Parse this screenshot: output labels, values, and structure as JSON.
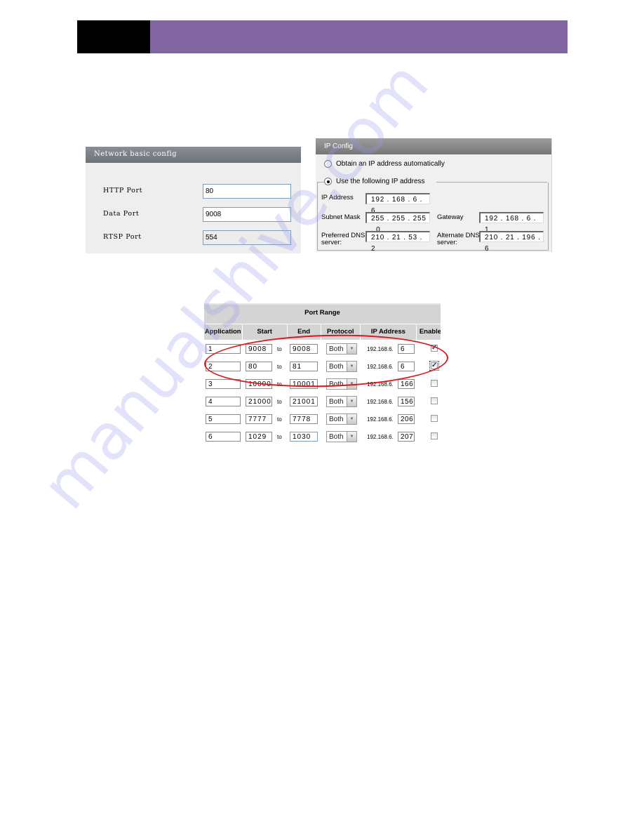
{
  "header": {
    "colors": {
      "left_block": "#000000",
      "band": "#8065a0"
    }
  },
  "network_basic_config": {
    "title": "Network basic config",
    "fields": [
      {
        "label": "HTTP Port",
        "value": "80",
        "disabled": false
      },
      {
        "label": "Data Port",
        "value": "9008",
        "disabled": false
      },
      {
        "label": "RTSP Port",
        "value": "554",
        "disabled": true
      }
    ]
  },
  "ip_config": {
    "title": "IP Config",
    "options": [
      {
        "label": "Obtain an IP address automatically",
        "selected": false
      },
      {
        "label": "Use the following IP address",
        "selected": true
      }
    ],
    "ip_address": {
      "label": "IP Address",
      "value": "192 . 168 .  6  . 6"
    },
    "subnet_mask": {
      "label": "Subnet Mask",
      "value": "255 . 255 . 255 . 0"
    },
    "gateway": {
      "label": "Gateway",
      "value": "192 . 168 .  6  . 1"
    },
    "preferred_dns": {
      "label_line1": "Preferred DNS",
      "label_line2": "server:",
      "value": "210 .  21  .  53  . 2"
    },
    "alternate_dns": {
      "label_line1": "Alternate DNS",
      "label_line2": "server:",
      "value": "210 .  21  . 196 . 6"
    }
  },
  "port_range": {
    "title": "Port Range",
    "columns": [
      "Application",
      "Start",
      "End",
      "Protocol",
      "IP Address",
      "Enable"
    ],
    "to_label": "to",
    "ip_prefix": "192.168.6.",
    "rows": [
      {
        "application": "1",
        "start": "9008",
        "end": "9008",
        "protocol": "Both",
        "ip_last": "6",
        "enabled": true
      },
      {
        "application": "2",
        "start": "80",
        "end": "81",
        "protocol": "Both",
        "ip_last": "6",
        "enabled": true
      },
      {
        "application": "3",
        "start": "10000",
        "end": "10001",
        "protocol": "Both",
        "ip_last": "166",
        "enabled": false
      },
      {
        "application": "4",
        "start": "21000",
        "end": "21001",
        "protocol": "Both",
        "ip_last": "156",
        "enabled": false
      },
      {
        "application": "5",
        "start": "7777",
        "end": "7778",
        "protocol": "Both",
        "ip_last": "206",
        "enabled": false
      },
      {
        "application": "6",
        "start": "1029",
        "end": "1030",
        "protocol": "Both",
        "ip_last": "207",
        "enabled": false
      }
    ],
    "highlight_color": "#e0141c"
  },
  "watermark": {
    "text": "manualshive.com"
  }
}
